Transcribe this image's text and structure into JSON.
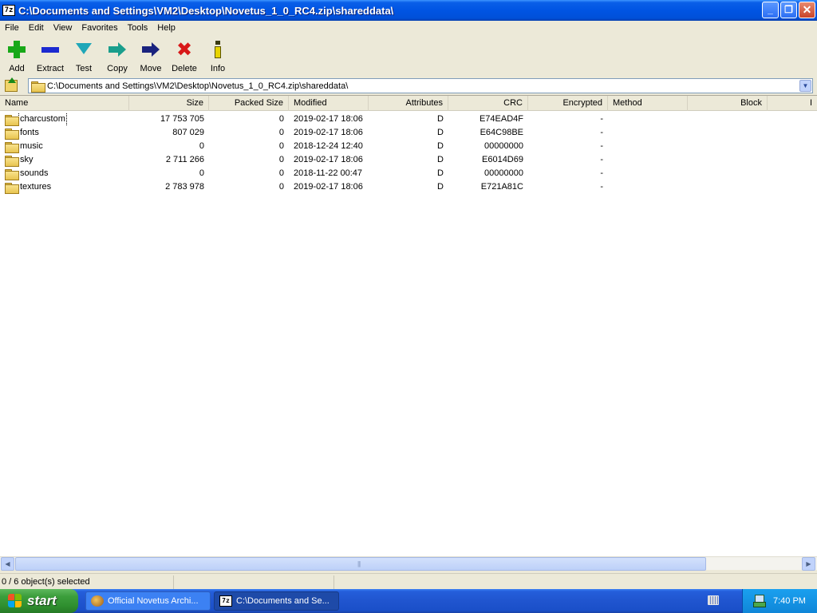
{
  "window": {
    "title": "C:\\Documents and Settings\\VM2\\Desktop\\Novetus_1_0_RC4.zip\\shareddata\\",
    "app_icon_text": "7z",
    "minimize_glyph": "_",
    "maximize_glyph": "❐",
    "close_glyph": "✕"
  },
  "menu": [
    "File",
    "Edit",
    "View",
    "Favorites",
    "Tools",
    "Help"
  ],
  "toolbar": {
    "add": "Add",
    "extract": "Extract",
    "test": "Test",
    "copy": "Copy",
    "move": "Move",
    "delete": "Delete",
    "info": "Info",
    "delete_glyph": "✖",
    "info_glyph": "i"
  },
  "address": {
    "path": "C:\\Documents and Settings\\VM2\\Desktop\\Novetus_1_0_RC4.zip\\shareddata\\",
    "dropdown_glyph": "▼"
  },
  "columns": {
    "name": "Name",
    "size": "Size",
    "packed_size": "Packed Size",
    "modified": "Modified",
    "attributes": "Attributes",
    "crc": "CRC",
    "encrypted": "Encrypted",
    "method": "Method",
    "block": "Block",
    "extra": "I"
  },
  "rows": [
    {
      "name": "charcustom",
      "size": "17 753 705",
      "packed": "0",
      "modified": "2019-02-17 18:06",
      "attributes": "D",
      "crc": "E74EAD4F",
      "encrypted": "-"
    },
    {
      "name": "fonts",
      "size": "807 029",
      "packed": "0",
      "modified": "2019-02-17 18:06",
      "attributes": "D",
      "crc": "E64C98BE",
      "encrypted": "-"
    },
    {
      "name": "music",
      "size": "0",
      "packed": "0",
      "modified": "2018-12-24 12:40",
      "attributes": "D",
      "crc": "00000000",
      "encrypted": "-"
    },
    {
      "name": "sky",
      "size": "2 711 266",
      "packed": "0",
      "modified": "2019-02-17 18:06",
      "attributes": "D",
      "crc": "E6014D69",
      "encrypted": "-"
    },
    {
      "name": "sounds",
      "size": "0",
      "packed": "0",
      "modified": "2018-11-22 00:47",
      "attributes": "D",
      "crc": "00000000",
      "encrypted": "-"
    },
    {
      "name": "textures",
      "size": "2 783 978",
      "packed": "0",
      "modified": "2019-02-17 18:06",
      "attributes": "D",
      "crc": "E721A81C",
      "encrypted": "-"
    }
  ],
  "scrollbar": {
    "left_glyph": "◀",
    "right_glyph": "▶"
  },
  "status": {
    "selection": "0 / 6 object(s) selected"
  },
  "taskbar": {
    "start_label": "start",
    "tasks": [
      {
        "label": "Official Novetus Archi..."
      },
      {
        "label": "C:\\Documents and Se..."
      }
    ],
    "task_icon_text": "7z",
    "clock": "7:40 PM"
  }
}
